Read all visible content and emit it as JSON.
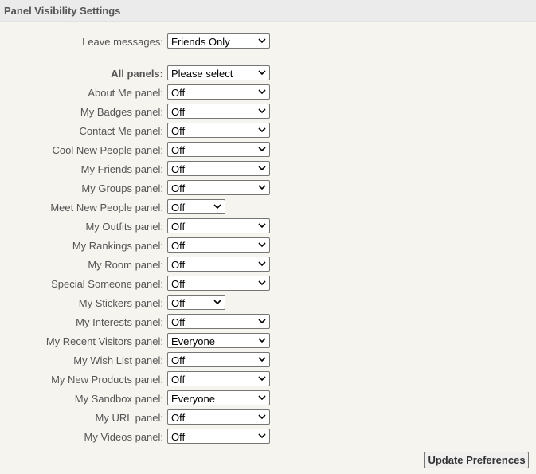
{
  "header": {
    "title": "Panel Visibility Settings"
  },
  "leave_messages": {
    "label": "Leave messages:",
    "value": "Friends Only"
  },
  "all_panels": {
    "label": "All panels:",
    "value": "Please select"
  },
  "panels": [
    {
      "label": "About Me panel:",
      "value": "Off"
    },
    {
      "label": "My Badges panel:",
      "value": "Off"
    },
    {
      "label": "Contact Me panel:",
      "value": "Off"
    },
    {
      "label": "Cool New People panel:",
      "value": "Off"
    },
    {
      "label": "My Friends panel:",
      "value": "Off"
    },
    {
      "label": "My Groups panel:",
      "value": "Off"
    },
    {
      "label": "Meet New People panel:",
      "value": "Off"
    },
    {
      "label": "My Outfits panel:",
      "value": "Off"
    },
    {
      "label": "My Rankings panel:",
      "value": "Off"
    },
    {
      "label": "My Room panel:",
      "value": "Off"
    },
    {
      "label": "Special Someone panel:",
      "value": "Off"
    },
    {
      "label": "My Stickers panel:",
      "value": "Off"
    },
    {
      "label": "My Interests panel:",
      "value": "Off"
    },
    {
      "label": "My Recent Visitors panel:",
      "value": "Everyone"
    },
    {
      "label": "My Wish List panel:",
      "value": "Off"
    },
    {
      "label": "My New Products panel:",
      "value": "Off"
    },
    {
      "label": "My Sandbox panel:",
      "value": "Everyone"
    },
    {
      "label": "My URL panel:",
      "value": "Off"
    },
    {
      "label": "My Videos panel:",
      "value": "Off"
    }
  ],
  "update_button": {
    "label": "Update Preferences"
  }
}
